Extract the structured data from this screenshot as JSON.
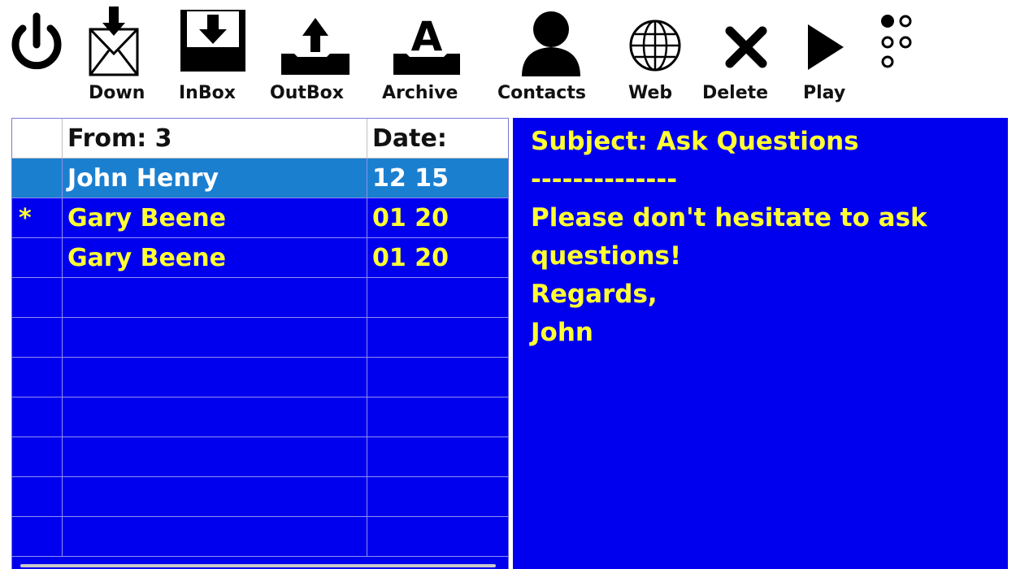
{
  "toolbar": {
    "power_icon": "power-icon",
    "buttons": [
      {
        "label": "Down",
        "icon": "envelope-download-icon"
      },
      {
        "label": "InBox",
        "icon": "inbox-icon"
      },
      {
        "label": "OutBox",
        "icon": "outbox-icon"
      },
      {
        "label": "Archive",
        "icon": "archive-icon"
      },
      {
        "label": "Contacts",
        "icon": "contact-person-icon"
      },
      {
        "label": "Web",
        "icon": "globe-icon"
      },
      {
        "label": "Delete",
        "icon": "delete-x-icon"
      },
      {
        "label": "Play",
        "icon": "play-icon"
      }
    ],
    "more_icon": "dots-menu-icon"
  },
  "message_list": {
    "header": {
      "mark": "",
      "from": "From:  3",
      "date": "Date:"
    },
    "rows": [
      {
        "mark": "",
        "from": "John Henry",
        "date": "12 15",
        "selected": true
      },
      {
        "mark": "*",
        "from": "Gary Beene",
        "date": "01 20",
        "selected": false
      },
      {
        "mark": "",
        "from": "Gary Beene",
        "date": "01 20",
        "selected": false
      }
    ]
  },
  "message_view": {
    "subject": "Subject: Ask Questions",
    "separator": "--------------",
    "body_lines": [
      "Please don't hesitate to ask",
      "questions!",
      "Regards,",
      "John"
    ]
  },
  "colors": {
    "panel_blue": "#0000ee",
    "selected_row": "#1b7fd0",
    "text_yellow": "#ffff33"
  }
}
